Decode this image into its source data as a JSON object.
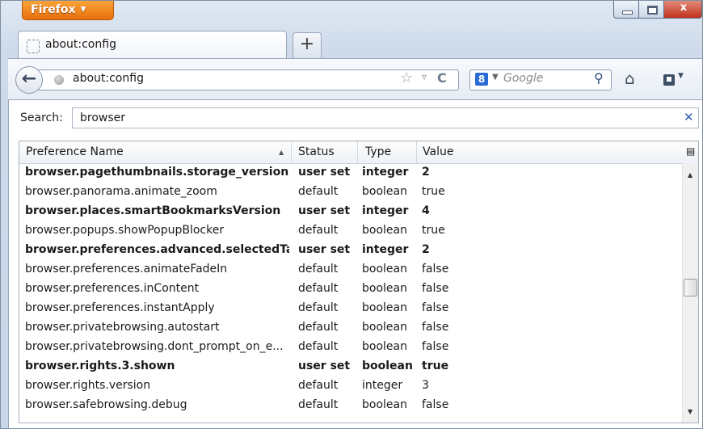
{
  "app_menu": {
    "label": "Firefox"
  },
  "window_controls": {
    "close": "x"
  },
  "tab": {
    "title": "about:config",
    "new_tab": "+"
  },
  "navbar": {
    "url": "about:config",
    "search_engine_placeholder": "Google"
  },
  "search": {
    "label": "Search:",
    "value": "browser"
  },
  "table": {
    "columns": [
      "Preference Name",
      "Status",
      "Type",
      "Value"
    ],
    "rows": [
      {
        "name": "browser.pagethumbnails.storage_version",
        "status": "user set",
        "type": "integer",
        "value": "2",
        "modified": true
      },
      {
        "name": "browser.panorama.animate_zoom",
        "status": "default",
        "type": "boolean",
        "value": "true",
        "modified": false
      },
      {
        "name": "browser.places.smartBookmarksVersion",
        "status": "user set",
        "type": "integer",
        "value": "4",
        "modified": true
      },
      {
        "name": "browser.popups.showPopupBlocker",
        "status": "default",
        "type": "boolean",
        "value": "true",
        "modified": false
      },
      {
        "name": "browser.preferences.advanced.selectedTa...",
        "status": "user set",
        "type": "integer",
        "value": "2",
        "modified": true
      },
      {
        "name": "browser.preferences.animateFadeIn",
        "status": "default",
        "type": "boolean",
        "value": "false",
        "modified": false
      },
      {
        "name": "browser.preferences.inContent",
        "status": "default",
        "type": "boolean",
        "value": "false",
        "modified": false
      },
      {
        "name": "browser.preferences.instantApply",
        "status": "default",
        "type": "boolean",
        "value": "false",
        "modified": false
      },
      {
        "name": "browser.privatebrowsing.autostart",
        "status": "default",
        "type": "boolean",
        "value": "false",
        "modified": false
      },
      {
        "name": "browser.privatebrowsing.dont_prompt_on_e...",
        "status": "default",
        "type": "boolean",
        "value": "false",
        "modified": false
      },
      {
        "name": "browser.rights.3.shown",
        "status": "user set",
        "type": "boolean",
        "value": "true",
        "modified": true
      },
      {
        "name": "browser.rights.version",
        "status": "default",
        "type": "integer",
        "value": "3",
        "modified": false
      },
      {
        "name": "browser.safebrowsing.debug",
        "status": "default",
        "type": "boolean",
        "value": "false",
        "modified": false
      }
    ]
  },
  "colors": {
    "firefox_orange": "#e86e0b",
    "close_red": "#c0321c",
    "accent_blue": "#2c5fb3"
  }
}
